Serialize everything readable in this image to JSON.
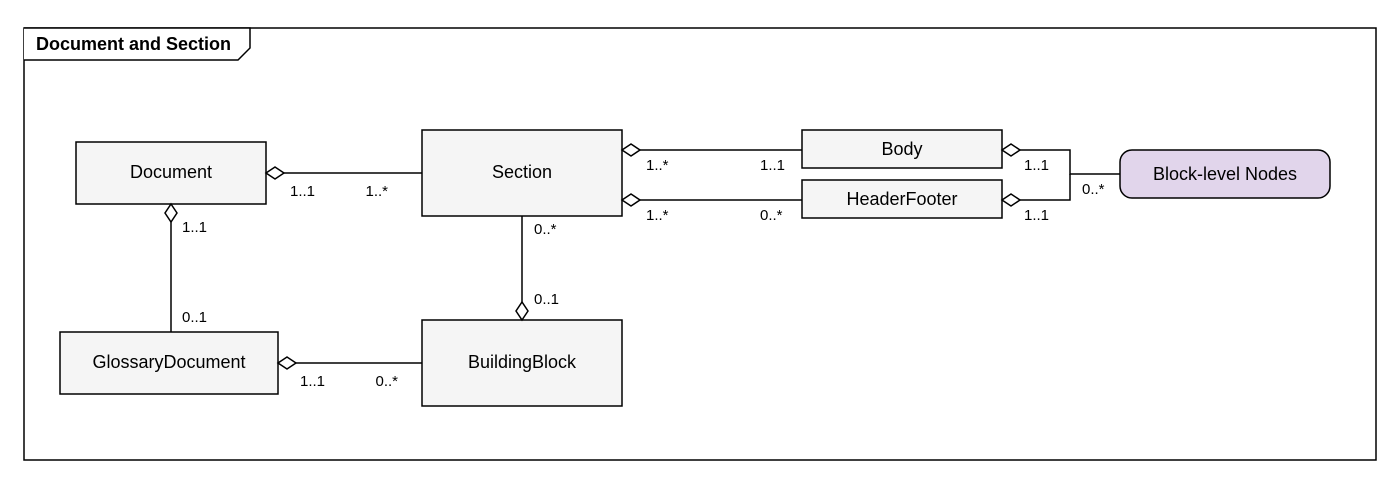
{
  "title": "Document and Section",
  "nodes": {
    "document": "Document",
    "section": "Section",
    "glossaryDocument": "GlossaryDocument",
    "buildingBlock": "BuildingBlock",
    "body": "Body",
    "headerFooter": "HeaderFooter",
    "blockLevelNodes": "Block-level Nodes"
  },
  "mult": {
    "docSection_doc": "1..1",
    "docSection_sec": "1..*",
    "docGlossary_doc": "1..1",
    "docGlossary_glos": "0..1",
    "glosBB_glos": "1..1",
    "glosBB_bb": "0..*",
    "bbSection_bb": "0..1",
    "bbSection_sec": "0..*",
    "secBody_sec": "1..*",
    "secBody_body": "1..1",
    "secHF_sec": "1..*",
    "secHF_hf": "0..*",
    "bodyBlock_body": "1..1",
    "bodyBlock_block": "0..*",
    "hfBlock_hf": "1..1"
  }
}
